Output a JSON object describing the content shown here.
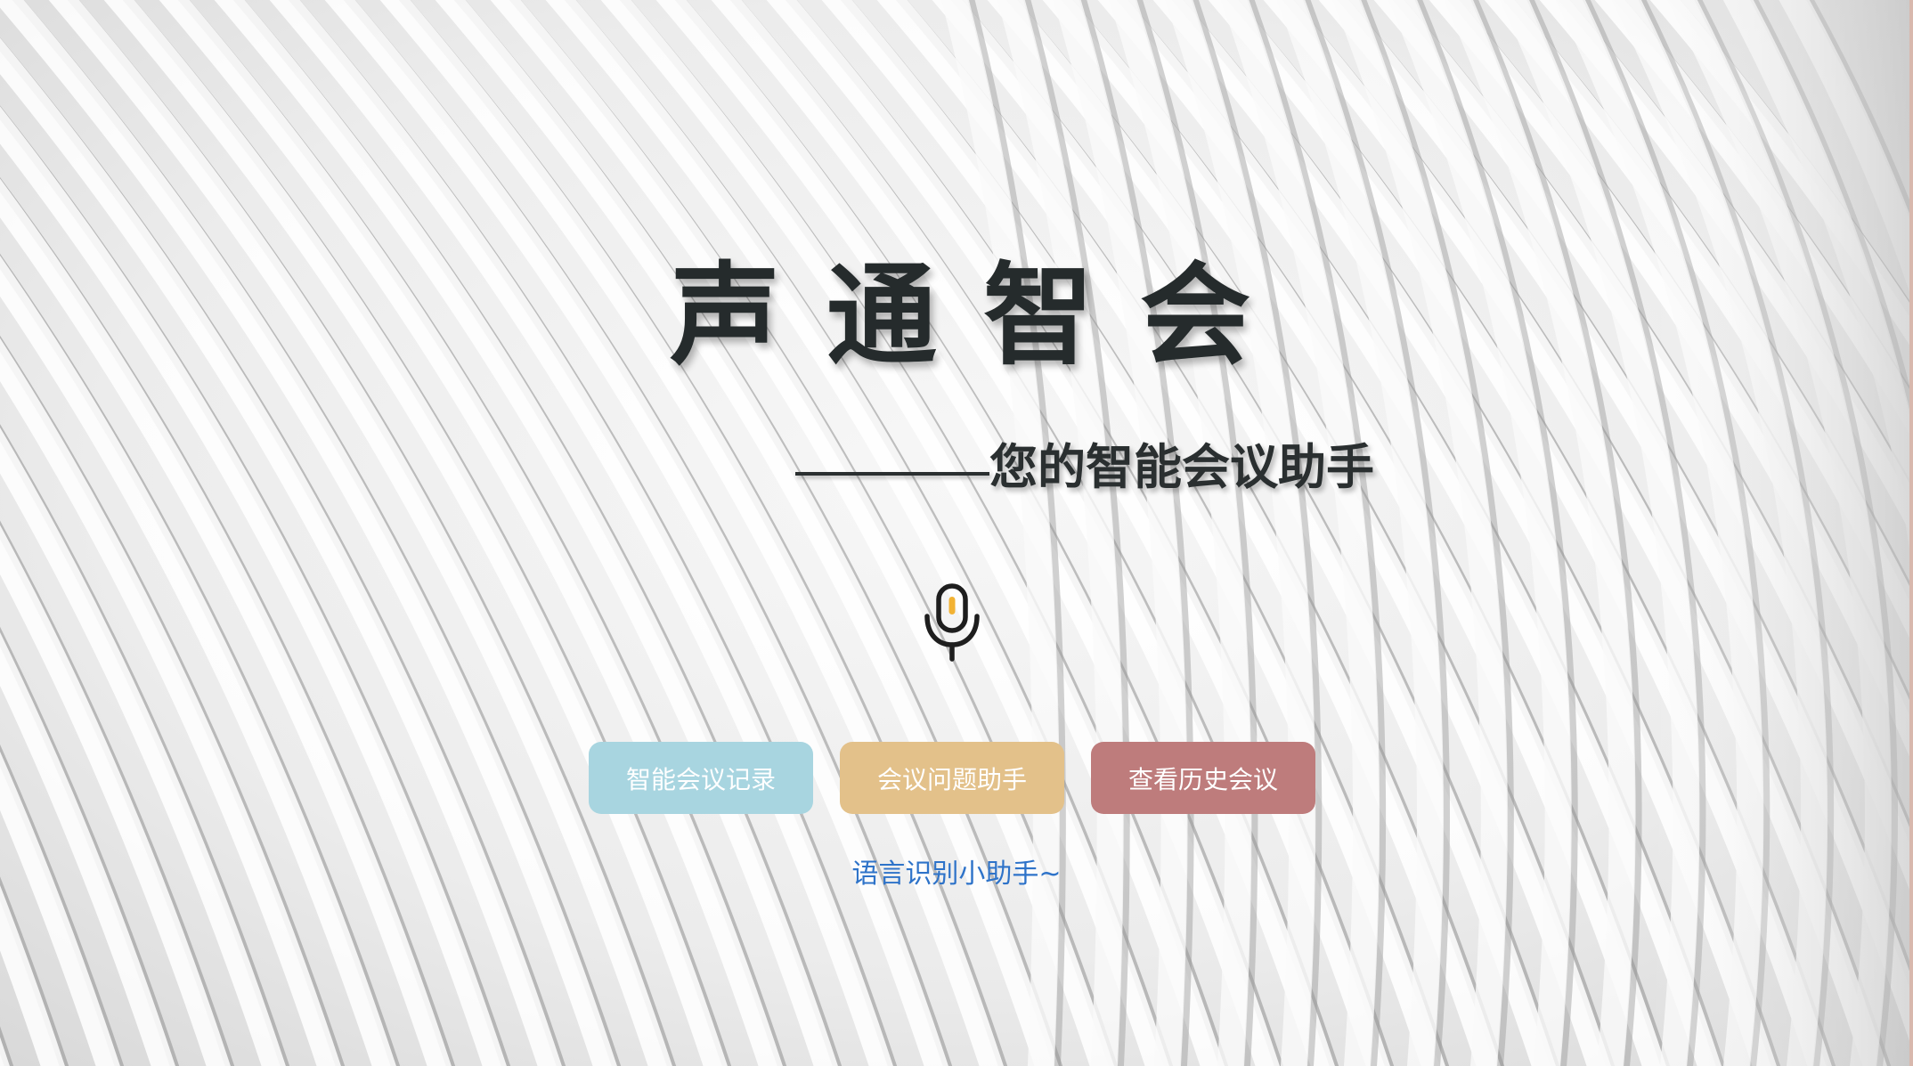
{
  "app": {
    "title": "声通智会",
    "subtitle": "您的智能会议助手"
  },
  "icons": {
    "microphone": "microphone-icon"
  },
  "buttons": {
    "record_label": "智能会议记录",
    "qa_label": "会议问题助手",
    "history_label": "查看历史会议"
  },
  "helper_link": "语言识别小助手~",
  "colors": {
    "record_button": "#a8d5e0",
    "qa_button": "#e3c18a",
    "history_button": "#be7c7c",
    "title_text": "#252b2c",
    "link_text": "#2e73c9",
    "mic_accent": "#f2b233"
  }
}
